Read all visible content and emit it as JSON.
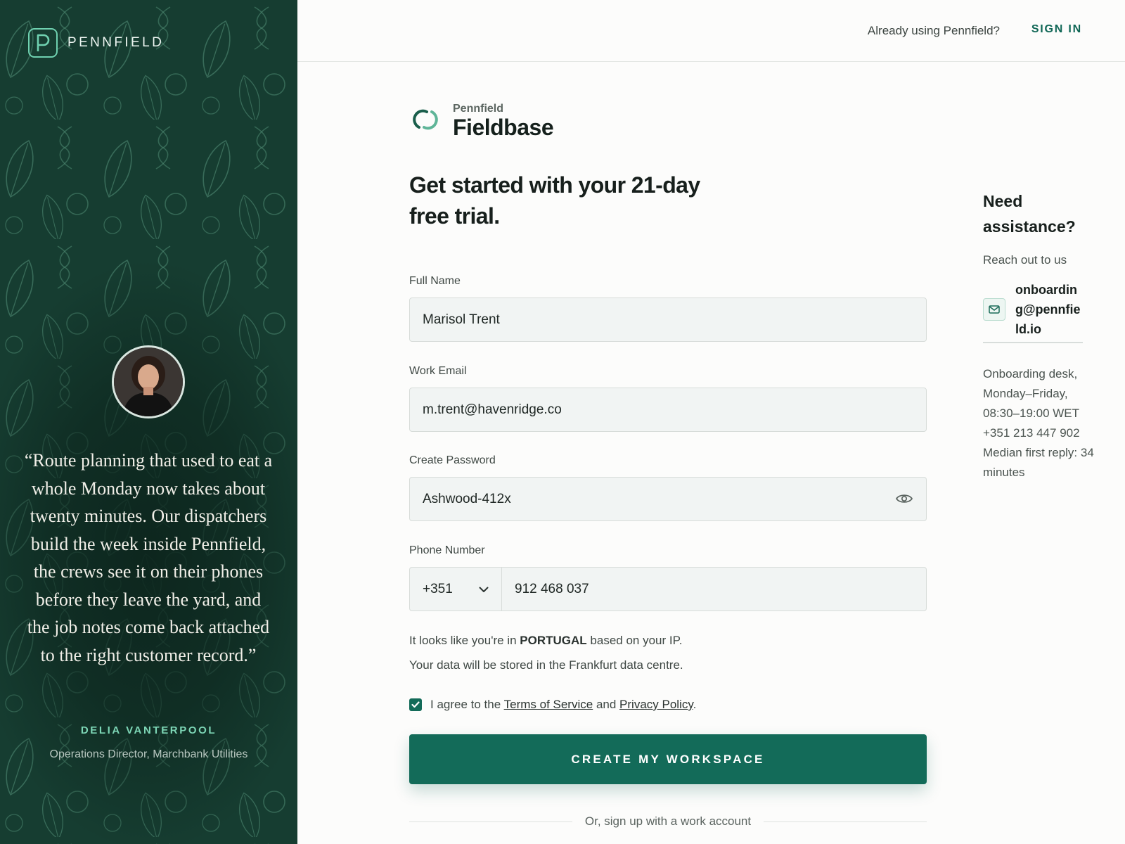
{
  "sidebar": {
    "brand_name": "PENNFIELD",
    "quote": "“Route planning that used to eat a whole Monday now takes about twenty minutes. Our dispatchers build the week inside Pennfield, the crews see it on their phones before they leave the yard, and the job notes come back attached to the right customer record.”",
    "quote_author": "DELIA VANTERPOOL",
    "quote_role": "Operations Director, Marchbank Utilities"
  },
  "topbar": {
    "question": "Already using Pennfield?",
    "signin_label": "SIGN IN"
  },
  "product": {
    "company": "Pennfield",
    "name": "Fieldbase"
  },
  "form": {
    "heading": "Get started with your 21-day free trial.",
    "full_name": {
      "label": "Full Name",
      "value": "Marisol Trent"
    },
    "work_email": {
      "label": "Work Email",
      "value": "m.trent@havenridge.co"
    },
    "password": {
      "label": "Create Password",
      "value": "Ashwood-412x"
    },
    "phone": {
      "label": "Phone Number",
      "country_code": "+351",
      "value": "912 468 037"
    },
    "location_prefix": "It looks like you're in",
    "location_country": "PORTUGAL",
    "location_suffix": "based on your IP.",
    "storage_note": "Your data will be stored in the Frankfurt data centre.",
    "agree_prefix": "I agree to the",
    "terms_link": "Terms of Service",
    "agree_and": "and",
    "privacy_link": "Privacy Policy",
    "agree_period": ".",
    "agree_checked": true,
    "submit_label": "CREATE MY WORKSPACE",
    "alt_signup": "Or, sign up with a work account"
  },
  "assistance": {
    "title": "Need assistance?",
    "reach": "Reach out to us",
    "email": "onboarding@pennfield.io",
    "hours": "Onboarding desk, Monday–Friday, 08:30–19:00 WET",
    "phone": "+351 213 447 902",
    "reply": "Median first reply: 34 minutes"
  },
  "colors": {
    "accent": "#136b59",
    "sidebar_bg": "#163d31",
    "highlight": "#7dd6b6"
  },
  "icons": [
    "brand-p-icon",
    "fieldbase-logo-icon",
    "eye-icon",
    "chevron-down-icon",
    "check-icon",
    "mail-icon"
  ]
}
